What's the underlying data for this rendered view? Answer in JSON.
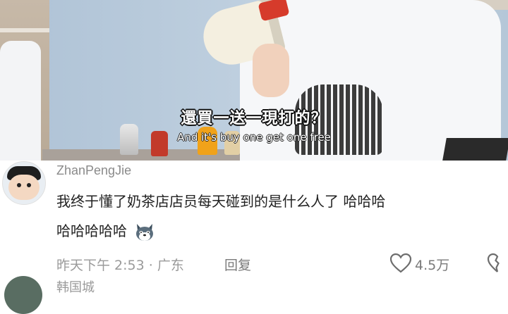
{
  "video": {
    "subtitle_cn": "還買一送一現打的？",
    "subtitle_en": "And it's buy one get one free"
  },
  "comment": {
    "username": "ZhanPengJie",
    "text_line1": "我终于懂了奶茶店店员每天碰到的是什么人了  哈哈哈",
    "text_line2": "哈哈哈哈哈",
    "emoji_icon": "husky-dog-emoji-icon",
    "time_location": "昨天下午 2:53 · 广东",
    "reply_label": "回复",
    "like_count": "4.5万"
  },
  "next_comment": {
    "username": "韩国城"
  }
}
